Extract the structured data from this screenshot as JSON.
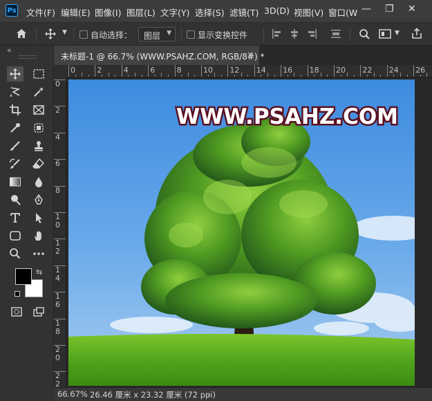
{
  "app": {
    "logo": "Ps"
  },
  "menubar": {
    "items": [
      "文件(F)",
      "编辑(E)",
      "图像(I)",
      "图层(L)",
      "文字(Y)",
      "选择(S)",
      "滤镜(T)",
      "3D(D)",
      "视图(V)",
      "窗口(W"
    ],
    "minimize": "—",
    "restore": "❐",
    "close": "✕"
  },
  "options": {
    "auto_select_label": "自动选择：",
    "layer_dropdown_value": "图层",
    "show_transform_label": "显示变换控件"
  },
  "panel_collapse": "«",
  "document": {
    "tab_title": "未标题-1 @ 66.7% (WWW.PSAHZ.COM, RGB/8#) *",
    "tab_close": "×",
    "watermark": "WWW.PSAHZ.COM"
  },
  "rulers": {
    "horizontal": [
      "0",
      "2",
      "4",
      "6",
      "8",
      "10",
      "12",
      "14",
      "16",
      "18",
      "20",
      "22",
      "24",
      "26"
    ],
    "vertical": [
      "0",
      "2",
      "4",
      "6",
      "8",
      "10",
      "12",
      "14",
      "16",
      "18",
      "20",
      "22"
    ]
  },
  "status": {
    "zoom": "66.67%",
    "doc_info": "26.46 厘米 x 23.32 厘米 (72 ppi)",
    "arrow": "›"
  },
  "colors": {
    "foreground": "#000000",
    "background": "#ffffff",
    "accent": "#31a8ff"
  }
}
